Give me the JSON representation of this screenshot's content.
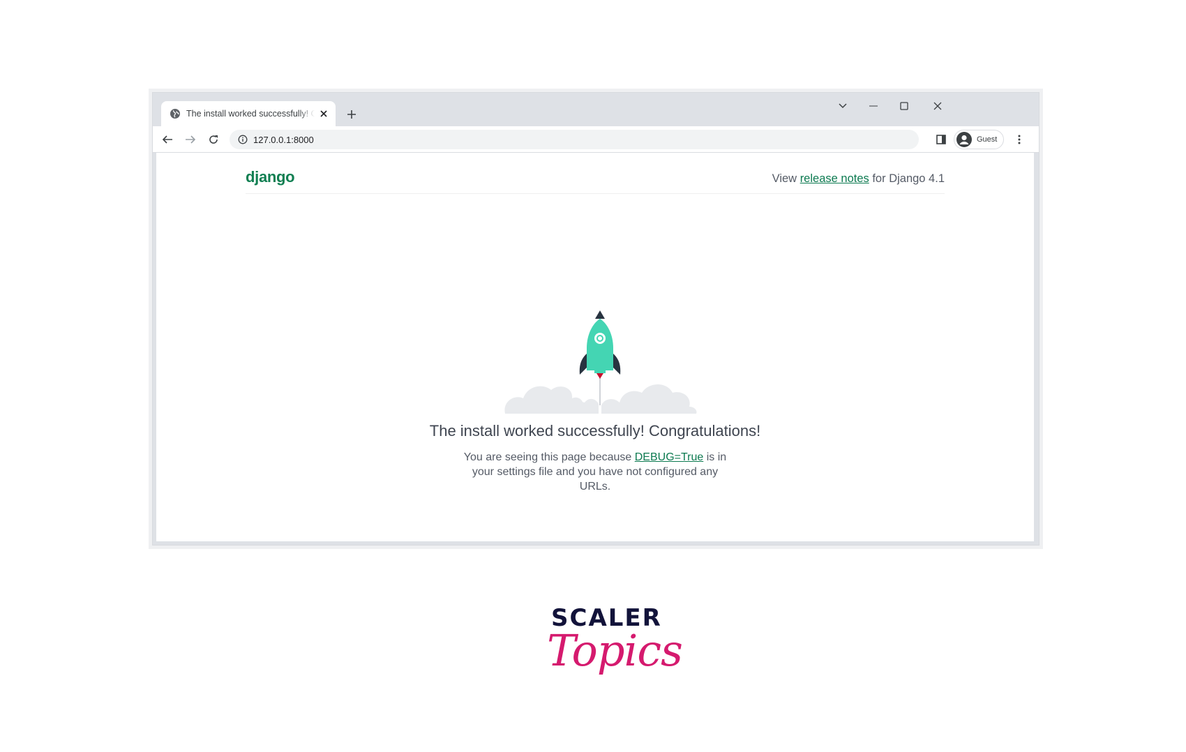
{
  "browser": {
    "tab_title": "The install worked successfully! Congratulations!",
    "url": "127.0.0.1:8000",
    "profile_label": "Guest"
  },
  "page": {
    "logo": "django",
    "release": {
      "prefix": "View ",
      "link": "release notes",
      "suffix": " for Django 4.1"
    },
    "hero_title": "The install worked successfully! Congratulations!",
    "desc": {
      "part1": "You are seeing this page because ",
      "link": "DEBUG=True",
      "part2": " is in your settings file and you have not configured any URLs."
    }
  },
  "brand": {
    "line1": "SCALER",
    "line2": "Topics"
  },
  "colors": {
    "django_green": "#117f52",
    "link_green": "#0c7a50",
    "rocket_teal": "#44d5b3",
    "scaler_navy": "#12133a",
    "topics_pink": "#d51a6e"
  }
}
